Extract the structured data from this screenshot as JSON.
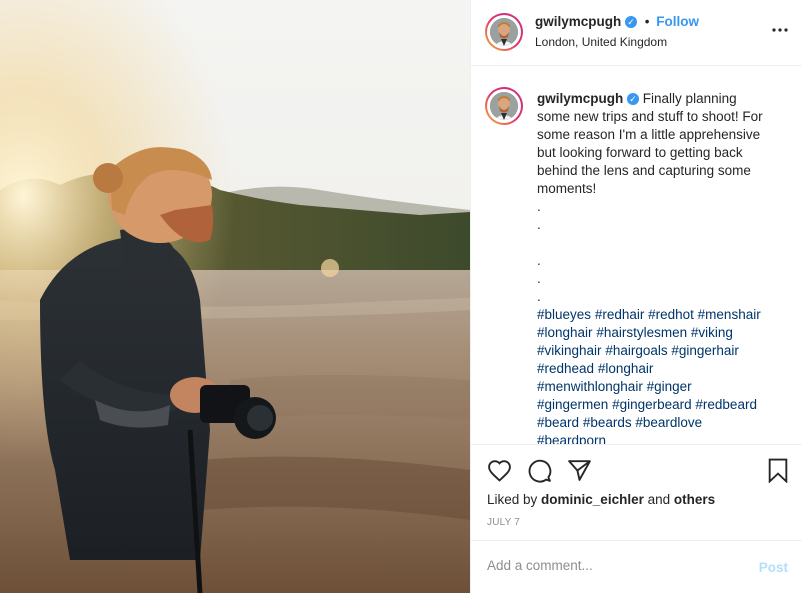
{
  "post": {
    "username": "gwilymcpugh",
    "verified_icon": "verified-badge-icon",
    "dot": "•",
    "follow_label": "Follow",
    "location": "London, United Kingdom",
    "more_label": "•••"
  },
  "caption": {
    "username": "gwilymcpugh",
    "text_lines": [
      "Finally planning",
      "some new trips and stuff to shoot! For",
      "some reason I'm a little apprehensive",
      "but looking forward to getting back",
      "behind the lens and capturing some",
      "moments!"
    ],
    "dots": [
      ".",
      ".",
      "",
      ".",
      ".",
      "."
    ],
    "hashtag_lines": [
      [
        "#blueyes",
        "#redhair",
        "#redhot",
        "#menshair"
      ],
      [
        "#longhair",
        "#hairstylesmen",
        "#viking"
      ],
      [
        "#vikinghair",
        "#hairgoals",
        "#gingerhair"
      ],
      [
        "#redhead",
        "#longhair"
      ],
      [
        "#menwithlonghair",
        "#ginger"
      ],
      [
        "#gingermen",
        "#gingerbeard",
        "#redbeard"
      ],
      [
        "#beard",
        "#beards",
        "#beardlove"
      ],
      [
        "#beardporn"
      ]
    ]
  },
  "actions": {
    "like_icon": "heart-icon",
    "comment_icon": "comment-icon",
    "share_icon": "share-icon",
    "save_icon": "bookmark-icon"
  },
  "likes": {
    "prefix": "Liked by ",
    "user": "dominic_eichler",
    "middle": " and ",
    "others": "others"
  },
  "date": "JULY 7",
  "comment_box": {
    "placeholder": "Add a comment...",
    "post_label": "Post"
  },
  "colors": {
    "link": "#3897f0",
    "hashtag": "#003569",
    "muted": "#8e8e8e",
    "post_disabled": "#b2dffc"
  }
}
